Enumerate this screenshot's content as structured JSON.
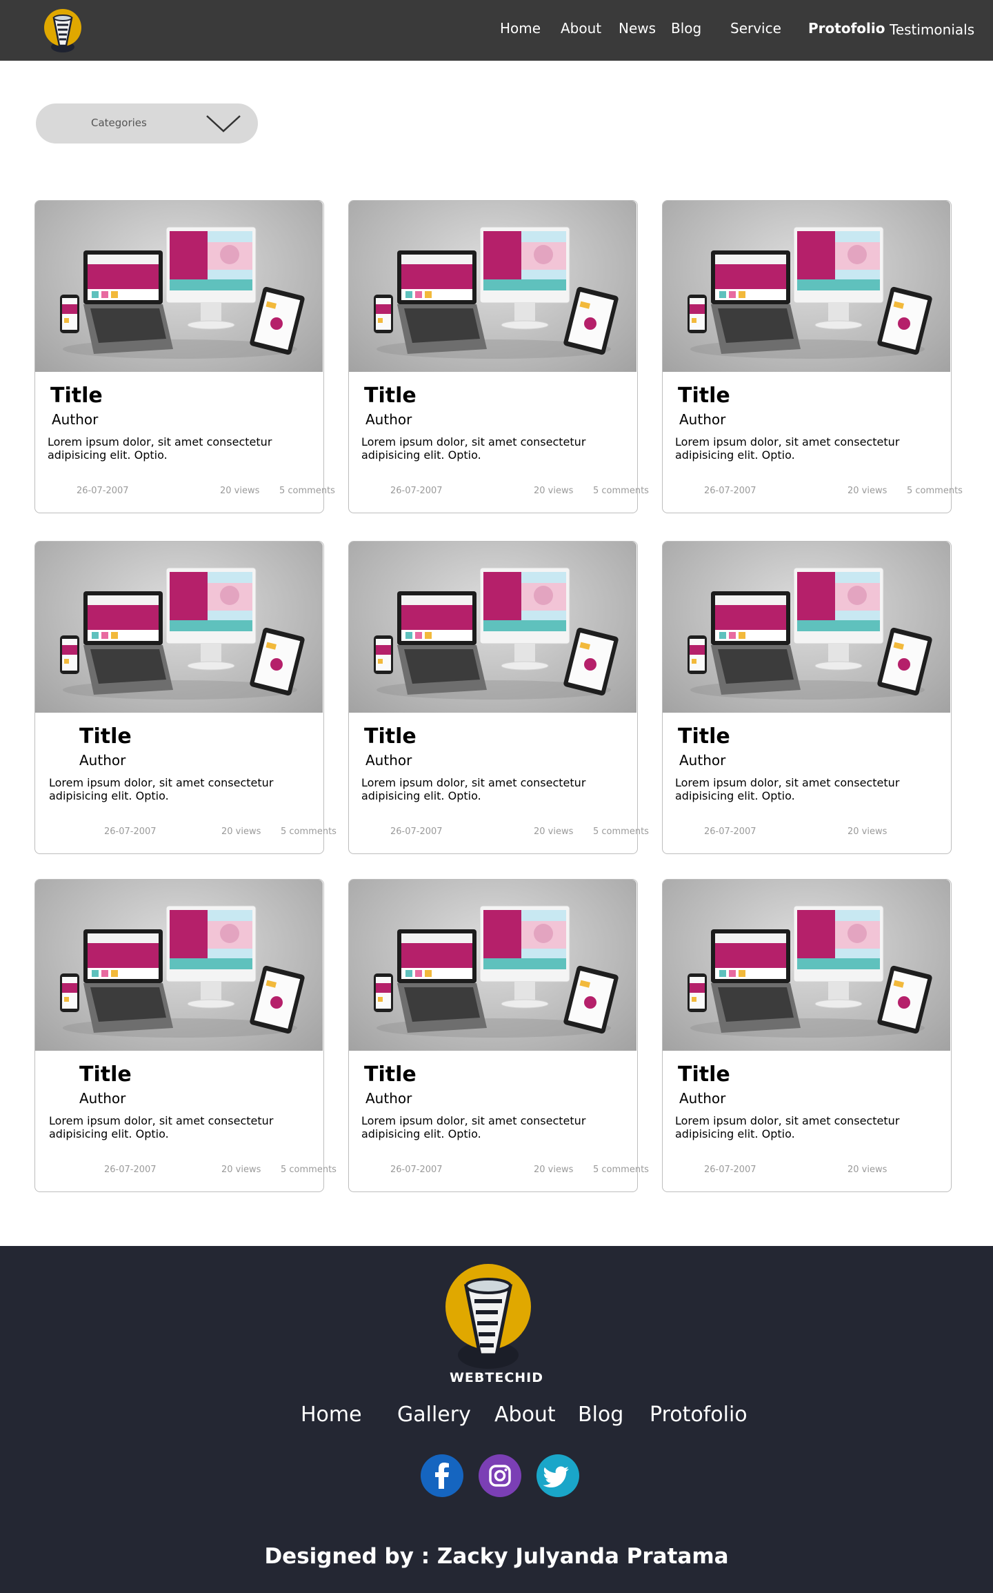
{
  "nav": {
    "logo_icon": "cup-logo-icon",
    "items": [
      {
        "label": "Home",
        "active": false
      },
      {
        "label": "About",
        "active": false
      },
      {
        "label": "News",
        "active": false
      },
      {
        "label": "Blog",
        "active": false
      },
      {
        "label": "Service",
        "active": false
      },
      {
        "label": "Protofolio",
        "active": true
      },
      {
        "label": "Testimonials",
        "active": false
      }
    ]
  },
  "filter": {
    "label": "Categories",
    "icon": "chevron-down-icon"
  },
  "cards": [
    {
      "title": "Title",
      "author": "Author",
      "excerpt": "Lorem ipsum dolor, sit amet consectetur adipisicing elit. Optio.",
      "date": "26-07-2007",
      "views": "20 views",
      "comments": "5 comments"
    },
    {
      "title": "Title",
      "author": "Author",
      "excerpt": "Lorem ipsum dolor, sit amet consectetur adipisicing elit. Optio.",
      "date": "26-07-2007",
      "views": "20 views",
      "comments": "5 comments"
    },
    {
      "title": "Title",
      "author": "Author",
      "excerpt": "Lorem ipsum dolor, sit amet consectetur adipisicing elit. Optio.",
      "date": "26-07-2007",
      "views": "20 views",
      "comments": "5 comments"
    },
    {
      "title": "Title",
      "author": "Author",
      "excerpt": "Lorem ipsum dolor, sit amet consectetur adipisicing elit. Optio.",
      "date": "26-07-2007",
      "views": "20 views",
      "comments": "5 comments"
    },
    {
      "title": "Title",
      "author": "Author",
      "excerpt": "Lorem ipsum dolor, sit amet consectetur adipisicing elit. Optio.",
      "date": "26-07-2007",
      "views": "20 views",
      "comments": "5 comments"
    },
    {
      "title": "Title",
      "author": "Author",
      "excerpt": "Lorem ipsum dolor, sit amet consectetur adipisicing elit. Optio.",
      "date": "26-07-2007",
      "views": "20 views",
      "comments": ""
    },
    {
      "title": "Title",
      "author": "Author",
      "excerpt": "Lorem ipsum dolor, sit amet consectetur adipisicing elit. Optio.",
      "date": "26-07-2007",
      "views": "20 views",
      "comments": "5 comments"
    },
    {
      "title": "Title",
      "author": "Author",
      "excerpt": "Lorem ipsum dolor, sit amet consectetur adipisicing elit. Optio.",
      "date": "26-07-2007",
      "views": "20 views",
      "comments": "5 comments"
    },
    {
      "title": "Title",
      "author": "Author",
      "excerpt": "Lorem ipsum dolor, sit amet consectetur adipisicing elit. Optio.",
      "date": "26-07-2007",
      "views": "20 views",
      "comments": ""
    }
  ],
  "footer": {
    "brand": "WEBTECHID",
    "links": [
      "Home",
      "Gallery",
      "About",
      "Blog",
      "Protofolio"
    ],
    "social": [
      {
        "icon": "facebook-icon",
        "color": "#1565c0"
      },
      {
        "icon": "instagram-icon",
        "color": "#7b3fb5"
      },
      {
        "icon": "twitter-icon",
        "color": "#1aa6c9"
      }
    ],
    "credit": "Designed by : Zacky Julyanda Pratama"
  },
  "colors": {
    "navbar": "#3a3a3a",
    "footer": "#242733",
    "logo_yellow": "#e0a800",
    "card_border": "#bdbdbd"
  }
}
